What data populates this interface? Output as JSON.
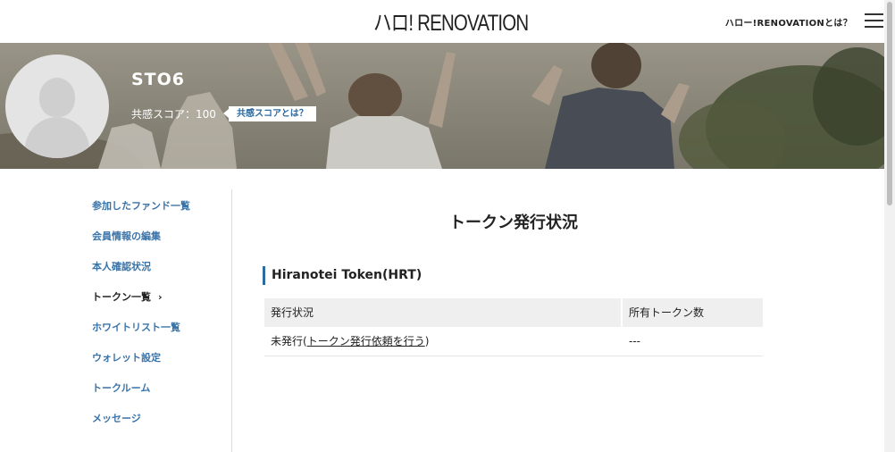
{
  "header": {
    "logo_text": "ハロ! RENOVATION",
    "about_label": "ハロー!RENOVATIONとは？"
  },
  "profile": {
    "username": "STO6",
    "score_label": "共感スコア：",
    "score_value": "100",
    "score_help_label": "共感スコアとは？"
  },
  "sidebar": {
    "items": [
      {
        "label": "参加したファンド一覧",
        "active": false
      },
      {
        "label": "会員情報の編集",
        "active": false
      },
      {
        "label": "本人確認状況",
        "active": false
      },
      {
        "label": "トークン一覧",
        "active": true
      },
      {
        "label": "ホワイトリスト一覧",
        "active": false
      },
      {
        "label": "ウォレット設定",
        "active": false
      },
      {
        "label": "トークルーム",
        "active": false
      },
      {
        "label": "メッセージ",
        "active": false
      }
    ]
  },
  "main": {
    "title": "トークン発行状況",
    "section_title": "Hiranotei Token(HRT)",
    "table": {
      "headers": [
        "発行状況",
        "所有トークン数"
      ],
      "rows": [
        {
          "status_prefix": "未発行(",
          "status_link": "トークン発行依頼を行う",
          "status_suffix": ")",
          "count": "---"
        }
      ]
    }
  },
  "colors": {
    "accent": "#2c6aa0",
    "link": "#3a73a8",
    "table_header_bg": "#efefef"
  },
  "icons": {
    "menu": "hamburger-menu-icon",
    "active_chevron": "chevron-right-icon",
    "avatar": "default-avatar-icon"
  }
}
